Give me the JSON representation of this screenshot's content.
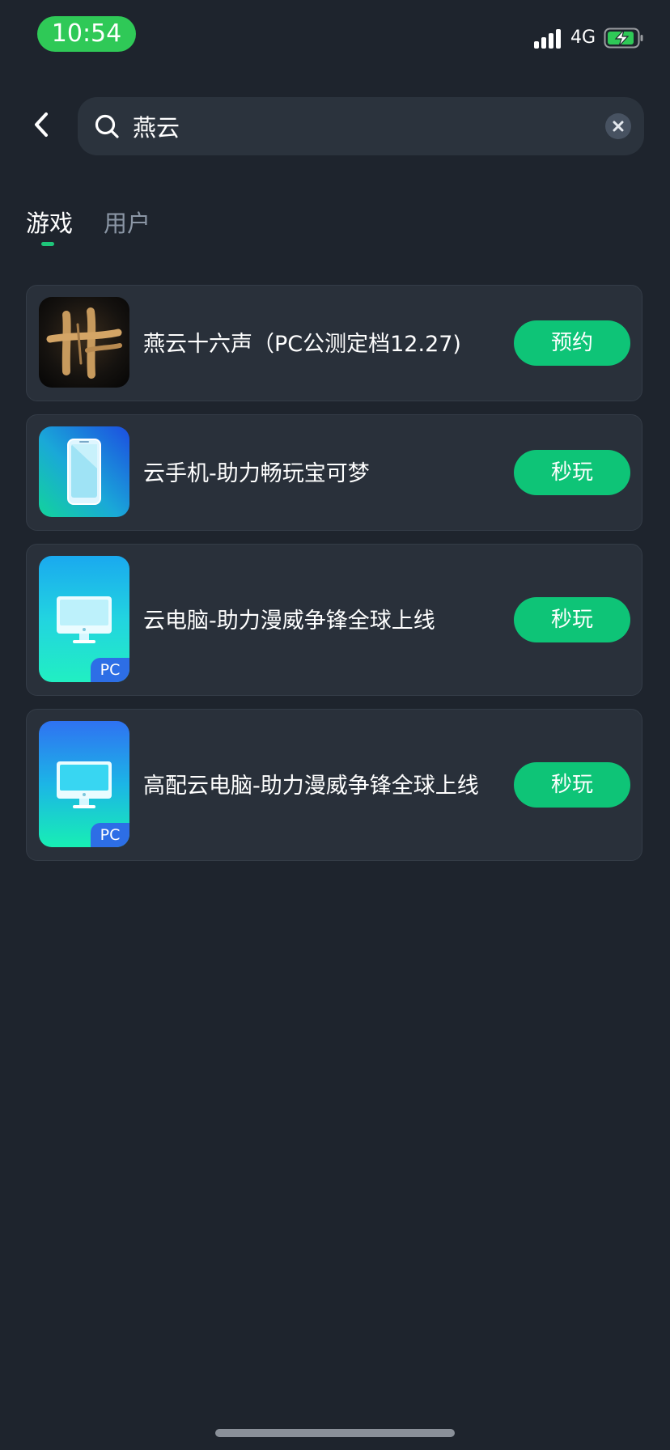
{
  "status_bar": {
    "time": "10:54",
    "network": "4G",
    "pill_color": "#2fc957",
    "battery_state": "charging"
  },
  "search": {
    "query": "燕云",
    "back_icon": "chevron-left-icon",
    "search_icon": "search-icon",
    "clear_icon": "clear-icon"
  },
  "tabs": [
    {
      "label": "游戏",
      "active": true
    },
    {
      "label": "用户",
      "active": false
    }
  ],
  "accent_color": "#0ec477",
  "results": [
    {
      "title": "燕云十六声（PC公测定档12.27)",
      "button": "预约",
      "icon": "yanyun-game-icon",
      "badge": ""
    },
    {
      "title": "云手机-助力畅玩宝可梦",
      "button": "秒玩",
      "icon": "cloud-phone-icon",
      "badge": ""
    },
    {
      "title": "云电脑-助力漫威争锋全球上线",
      "button": "秒玩",
      "icon": "cloud-pc-icon",
      "badge": "PC"
    },
    {
      "title": "高配云电脑-助力漫威争锋全球上线",
      "button": "秒玩",
      "icon": "high-spec-cloud-pc-icon",
      "badge": "PC"
    }
  ]
}
